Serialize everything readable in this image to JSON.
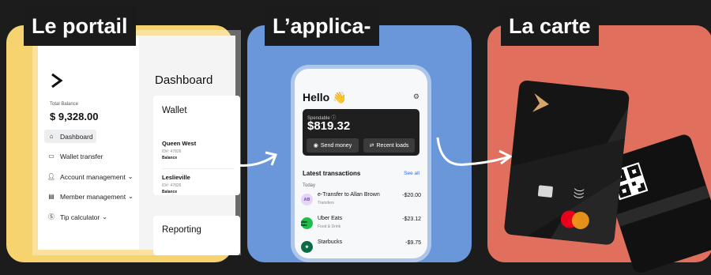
{
  "sections": {
    "portal_label": "Le portail",
    "app_label": "L’applica-",
    "card_label": "La carte"
  },
  "portal": {
    "total_balance_label": "Total Balance",
    "total_balance_value": "$ 9,328.00",
    "nav": [
      {
        "label": "Dashboard",
        "icon": "home-icon",
        "active": true
      },
      {
        "label": "Wallet transfer",
        "icon": "wallet-icon",
        "active": false
      },
      {
        "label": "Account management",
        "icon": "user-icon",
        "active": false
      },
      {
        "label": "Member management",
        "icon": "card-icon",
        "active": false
      },
      {
        "label": "Tip calculator",
        "icon": "dollar-icon",
        "active": false
      }
    ],
    "dashboard_title": "Dashboard",
    "wallet_title": "Wallet",
    "accounts": [
      {
        "name": "Queen West",
        "id": "ID#: 47826",
        "balance_label": "Balance"
      },
      {
        "name": "Leslieville",
        "id": "ID#: 47826",
        "balance_label": "Balance"
      }
    ],
    "reporting_title": "Reporting"
  },
  "app": {
    "greeting": "Hello 👋",
    "spendable_label": "Spendable ⓘ",
    "spendable_value": "$819.32",
    "send_money": "Send money",
    "recent_loads": "Recent loads",
    "latest_transactions": "Latest transactions",
    "see_all": "See all",
    "today": "Today",
    "transactions": [
      {
        "initials": "AB",
        "name": "e-Transfer to Allan Brown",
        "category": "Transfers",
        "amount": "-$20.00",
        "color": "#e4d6f7",
        "text_color": "#7b45c9"
      },
      {
        "initials": "Uber Eats",
        "name": "Uber Eats",
        "category": "Food & Drink",
        "amount": "-$23.12",
        "color": "#1fbd4a",
        "text_color": "#000000"
      },
      {
        "initials": "★",
        "name": "Starbucks",
        "category": "",
        "amount": "-$9.75",
        "color": "#0d6a45",
        "text_color": "#ffffff"
      }
    ]
  },
  "colors": {
    "portal_bg": "#f6d36e",
    "app_bg": "#6a97d9",
    "card_bg": "#e0705d",
    "card_accent": "#d5a46a"
  }
}
